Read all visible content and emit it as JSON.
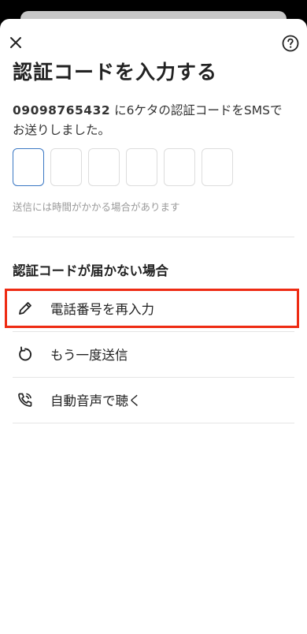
{
  "header": {
    "close_icon": "close-icon",
    "help_icon": "help-icon"
  },
  "title": "認証コードを入力する",
  "description": {
    "phone": "09098765432",
    "text_line1": " に6ケタの認証コードをSMSで",
    "text_line2": "お送りしました。"
  },
  "code_input": {
    "digits": [
      "",
      "",
      "",
      "",
      "",
      ""
    ]
  },
  "hint": "送信には時間がかかる場合があります",
  "section_title": "認証コードが届かない場合",
  "options": [
    {
      "label": "電話番号を再入力",
      "icon": "pencil-icon"
    },
    {
      "label": "もう一度送信",
      "icon": "refresh-icon"
    },
    {
      "label": "自動音声で聴く",
      "icon": "phone-voice-icon"
    }
  ],
  "colors": {
    "active_border": "#3b78c4",
    "highlight": "#ee2b13"
  }
}
